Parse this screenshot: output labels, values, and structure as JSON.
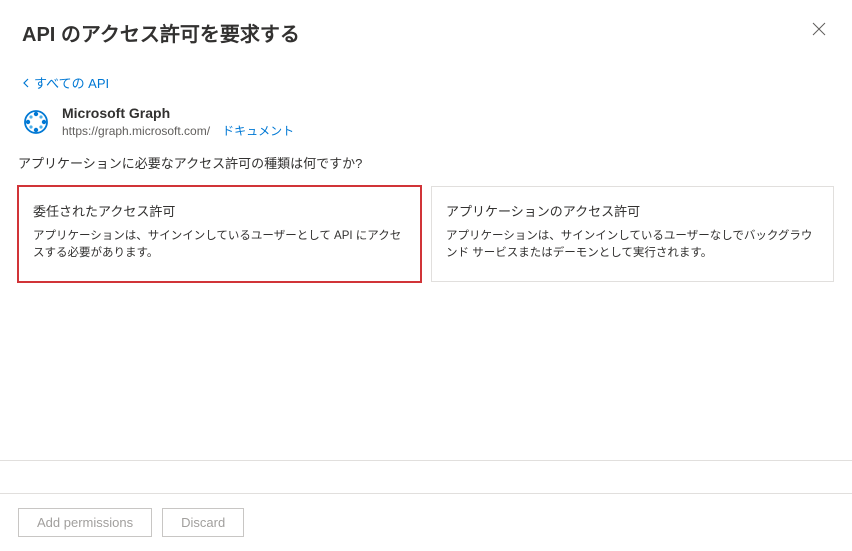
{
  "header": {
    "title": "API のアクセス許可を要求する"
  },
  "breadcrumb": {
    "label": "すべての API"
  },
  "api": {
    "name": "Microsoft Graph",
    "url": "https://graph.microsoft.com/",
    "docs_link": "ドキュメント"
  },
  "question": {
    "text": "アプリケーションに必要なアクセス許可の種類は何ですか?"
  },
  "options": {
    "delegated": {
      "title": "委任されたアクセス許可",
      "desc": "アプリケーションは、サインインしているユーザーとして API にアクセスする必要があります。"
    },
    "application": {
      "title": "アプリケーションのアクセス許可",
      "desc": "アプリケーションは、サインインしているユーザーなしでバックグラウンド サービスまたはデーモンとして実行されます。"
    }
  },
  "footer": {
    "add": "Add permissions",
    "discard": "Discard"
  }
}
